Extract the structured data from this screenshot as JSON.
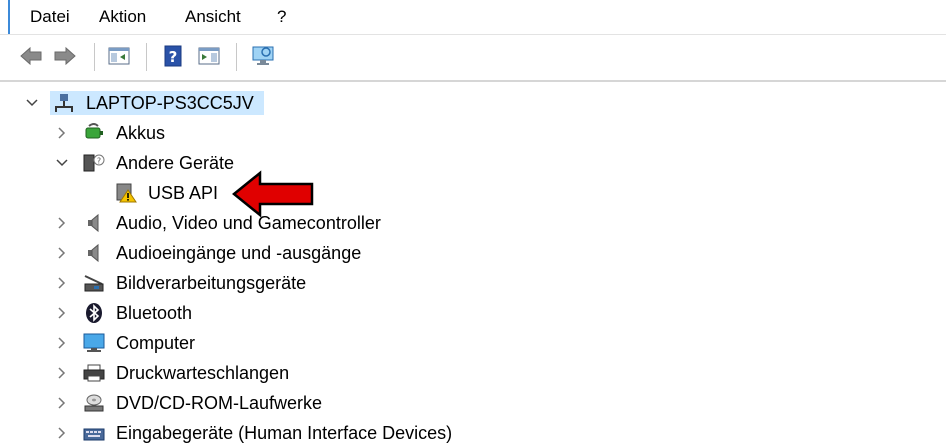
{
  "menu": {
    "items": [
      "Datei",
      "Aktion",
      "Ansicht",
      "?"
    ]
  },
  "toolbar": {
    "buttons": [
      "back-arrow-icon",
      "forward-arrow-icon",
      "show-hide-console-tree-icon",
      "help-icon",
      "action-pane-icon",
      "monitor-icon"
    ]
  },
  "tree": {
    "root": {
      "label": "LAPTOP-PS3CC5JV",
      "icon": "computer-network-icon",
      "expanded": true
    },
    "categories": [
      {
        "label": "Akkus",
        "icon": "battery-icon",
        "expanded": false
      },
      {
        "label": "Andere Geräte",
        "icon": "unknown-device-icon",
        "expanded": true,
        "children": [
          {
            "label": "USB API",
            "icon": "warning-device-icon"
          }
        ]
      },
      {
        "label": "Audio, Video und Gamecontroller",
        "icon": "speaker-icon",
        "expanded": false
      },
      {
        "label": "Audioeingänge und -ausgänge",
        "icon": "speaker-icon",
        "expanded": false
      },
      {
        "label": "Bildverarbeitungsgeräte",
        "icon": "scanner-icon",
        "expanded": false
      },
      {
        "label": "Bluetooth",
        "icon": "bluetooth-icon",
        "expanded": false
      },
      {
        "label": "Computer",
        "icon": "monitor-icon",
        "expanded": false
      },
      {
        "label": "Druckwarteschlangen",
        "icon": "printer-icon",
        "expanded": false
      },
      {
        "label": "DVD/CD-ROM-Laufwerke",
        "icon": "optical-drive-icon",
        "expanded": false
      },
      {
        "label": "Eingabegeräte (Human Interface Devices)",
        "icon": "keyboard-icon",
        "expanded": false
      }
    ]
  },
  "colors": {
    "selection": "#cce8ff",
    "arrow": "#e00000",
    "accent": "#3c8ad9"
  },
  "annotation": {
    "type": "red-arrow",
    "points_to": "USB API"
  }
}
